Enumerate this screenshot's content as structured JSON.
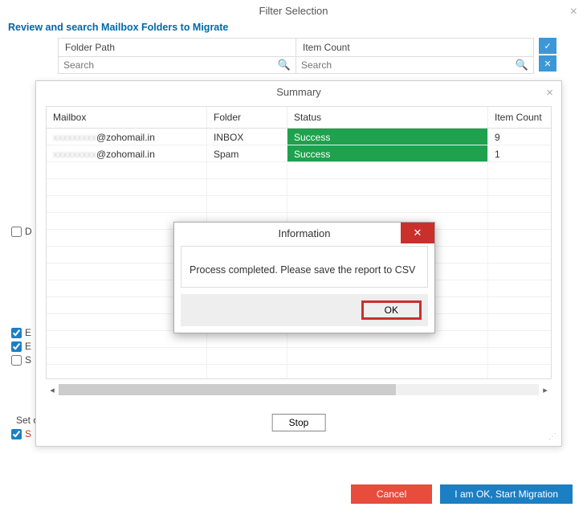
{
  "main": {
    "title": "Filter Selection",
    "instruction": "Review and search Mailbox Folders to Migrate",
    "col1": "Folder Path",
    "col2": "Item Count",
    "search_ph": "Search"
  },
  "checks": {
    "d": "D",
    "e1": "E",
    "e2": "E",
    "s": "S",
    "set": "Set o",
    "sred": "S"
  },
  "footer": {
    "cancel": "Cancel",
    "ok": "I am OK, Start Migration"
  },
  "summary": {
    "title": "Summary",
    "cols": {
      "mailbox": "Mailbox",
      "folder": "Folder",
      "status": "Status",
      "itemcount": "Item Count"
    },
    "rows": [
      {
        "mailbox_hidden": "xxxxxxxxx",
        "mailbox_suffix": "@zohomail.in",
        "folder": "INBOX",
        "status": "Success",
        "count": "9"
      },
      {
        "mailbox_hidden": "xxxxxxxxx",
        "mailbox_suffix": "@zohomail.in",
        "folder": "Spam",
        "status": "Success",
        "count": "1"
      }
    ],
    "stop": "Stop"
  },
  "info": {
    "title": "Information",
    "message": "Process completed. Please save the report to CSV",
    "ok": "OK"
  }
}
